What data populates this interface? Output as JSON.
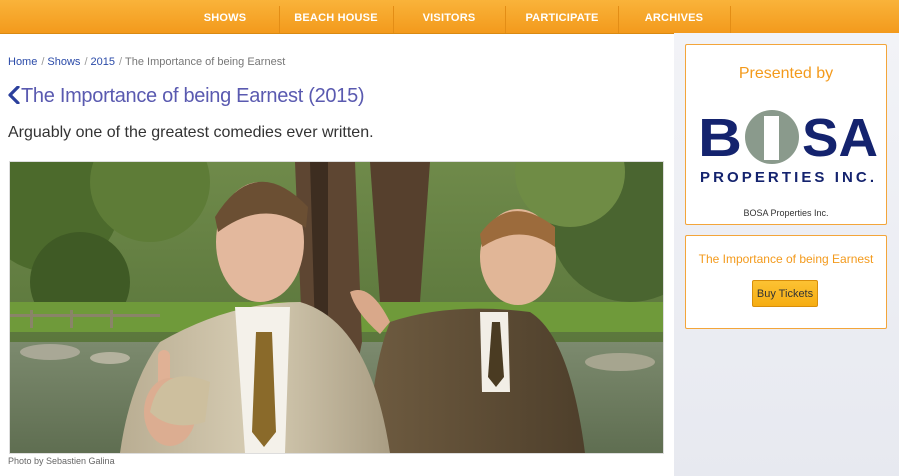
{
  "nav": {
    "items": [
      {
        "label": "SHOWS"
      },
      {
        "label": "BEACH HOUSE"
      },
      {
        "label": "VISITORS"
      },
      {
        "label": "PARTICIPATE"
      },
      {
        "label": "ARCHIVES"
      }
    ]
  },
  "breadcrumb": {
    "home": "Home",
    "shows": "Shows",
    "year": "2015",
    "current": "The Importance of being Earnest",
    "separator": "/"
  },
  "page": {
    "back_icon": "chevron-left-icon",
    "title": "The Importance of being Earnest (2015)",
    "subtitle": "Arguably one of the greatest comedies ever written.",
    "photo_credit": "Photo by Sebastien Galina"
  },
  "sidebar": {
    "sponsor_heading": "Presented by",
    "sponsor_logo_top": "BOSA",
    "sponsor_logo_bottom": "PROPERTIES INC.",
    "sponsor_caption": "BOSA Properties Inc.",
    "show_name": "The Importance of being Earnest",
    "buy_label": "Buy Tickets"
  },
  "colors": {
    "nav_orange": "#f39a1c",
    "link_blue": "#2a4aa8",
    "title_purple": "#5a5ab0",
    "bosa_navy": "#14236e",
    "bosa_grey": "#8a9a8c"
  }
}
